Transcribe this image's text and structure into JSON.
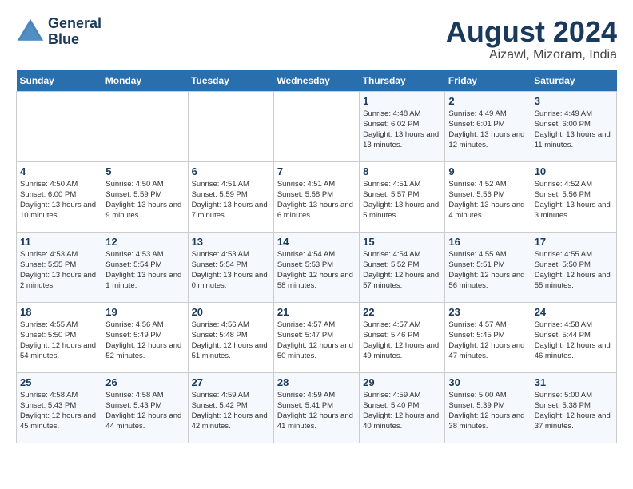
{
  "logo": {
    "line1": "General",
    "line2": "Blue"
  },
  "title": "August 2024",
  "subtitle": "Aizawl, Mizoram, India",
  "days_of_week": [
    "Sunday",
    "Monday",
    "Tuesday",
    "Wednesday",
    "Thursday",
    "Friday",
    "Saturday"
  ],
  "weeks": [
    [
      {
        "day": "",
        "info": ""
      },
      {
        "day": "",
        "info": ""
      },
      {
        "day": "",
        "info": ""
      },
      {
        "day": "",
        "info": ""
      },
      {
        "day": "1",
        "info": "Sunrise: 4:48 AM\nSunset: 6:02 PM\nDaylight: 13 hours and 13 minutes."
      },
      {
        "day": "2",
        "info": "Sunrise: 4:49 AM\nSunset: 6:01 PM\nDaylight: 13 hours and 12 minutes."
      },
      {
        "day": "3",
        "info": "Sunrise: 4:49 AM\nSunset: 6:00 PM\nDaylight: 13 hours and 11 minutes."
      }
    ],
    [
      {
        "day": "4",
        "info": "Sunrise: 4:50 AM\nSunset: 6:00 PM\nDaylight: 13 hours and 10 minutes."
      },
      {
        "day": "5",
        "info": "Sunrise: 4:50 AM\nSunset: 5:59 PM\nDaylight: 13 hours and 9 minutes."
      },
      {
        "day": "6",
        "info": "Sunrise: 4:51 AM\nSunset: 5:59 PM\nDaylight: 13 hours and 7 minutes."
      },
      {
        "day": "7",
        "info": "Sunrise: 4:51 AM\nSunset: 5:58 PM\nDaylight: 13 hours and 6 minutes."
      },
      {
        "day": "8",
        "info": "Sunrise: 4:51 AM\nSunset: 5:57 PM\nDaylight: 13 hours and 5 minutes."
      },
      {
        "day": "9",
        "info": "Sunrise: 4:52 AM\nSunset: 5:56 PM\nDaylight: 13 hours and 4 minutes."
      },
      {
        "day": "10",
        "info": "Sunrise: 4:52 AM\nSunset: 5:56 PM\nDaylight: 13 hours and 3 minutes."
      }
    ],
    [
      {
        "day": "11",
        "info": "Sunrise: 4:53 AM\nSunset: 5:55 PM\nDaylight: 13 hours and 2 minutes."
      },
      {
        "day": "12",
        "info": "Sunrise: 4:53 AM\nSunset: 5:54 PM\nDaylight: 13 hours and 1 minute."
      },
      {
        "day": "13",
        "info": "Sunrise: 4:53 AM\nSunset: 5:54 PM\nDaylight: 13 hours and 0 minutes."
      },
      {
        "day": "14",
        "info": "Sunrise: 4:54 AM\nSunset: 5:53 PM\nDaylight: 12 hours and 58 minutes."
      },
      {
        "day": "15",
        "info": "Sunrise: 4:54 AM\nSunset: 5:52 PM\nDaylight: 12 hours and 57 minutes."
      },
      {
        "day": "16",
        "info": "Sunrise: 4:55 AM\nSunset: 5:51 PM\nDaylight: 12 hours and 56 minutes."
      },
      {
        "day": "17",
        "info": "Sunrise: 4:55 AM\nSunset: 5:50 PM\nDaylight: 12 hours and 55 minutes."
      }
    ],
    [
      {
        "day": "18",
        "info": "Sunrise: 4:55 AM\nSunset: 5:50 PM\nDaylight: 12 hours and 54 minutes."
      },
      {
        "day": "19",
        "info": "Sunrise: 4:56 AM\nSunset: 5:49 PM\nDaylight: 12 hours and 52 minutes."
      },
      {
        "day": "20",
        "info": "Sunrise: 4:56 AM\nSunset: 5:48 PM\nDaylight: 12 hours and 51 minutes."
      },
      {
        "day": "21",
        "info": "Sunrise: 4:57 AM\nSunset: 5:47 PM\nDaylight: 12 hours and 50 minutes."
      },
      {
        "day": "22",
        "info": "Sunrise: 4:57 AM\nSunset: 5:46 PM\nDaylight: 12 hours and 49 minutes."
      },
      {
        "day": "23",
        "info": "Sunrise: 4:57 AM\nSunset: 5:45 PM\nDaylight: 12 hours and 47 minutes."
      },
      {
        "day": "24",
        "info": "Sunrise: 4:58 AM\nSunset: 5:44 PM\nDaylight: 12 hours and 46 minutes."
      }
    ],
    [
      {
        "day": "25",
        "info": "Sunrise: 4:58 AM\nSunset: 5:43 PM\nDaylight: 12 hours and 45 minutes."
      },
      {
        "day": "26",
        "info": "Sunrise: 4:58 AM\nSunset: 5:43 PM\nDaylight: 12 hours and 44 minutes."
      },
      {
        "day": "27",
        "info": "Sunrise: 4:59 AM\nSunset: 5:42 PM\nDaylight: 12 hours and 42 minutes."
      },
      {
        "day": "28",
        "info": "Sunrise: 4:59 AM\nSunset: 5:41 PM\nDaylight: 12 hours and 41 minutes."
      },
      {
        "day": "29",
        "info": "Sunrise: 4:59 AM\nSunset: 5:40 PM\nDaylight: 12 hours and 40 minutes."
      },
      {
        "day": "30",
        "info": "Sunrise: 5:00 AM\nSunset: 5:39 PM\nDaylight: 12 hours and 38 minutes."
      },
      {
        "day": "31",
        "info": "Sunrise: 5:00 AM\nSunset: 5:38 PM\nDaylight: 12 hours and 37 minutes."
      }
    ]
  ]
}
